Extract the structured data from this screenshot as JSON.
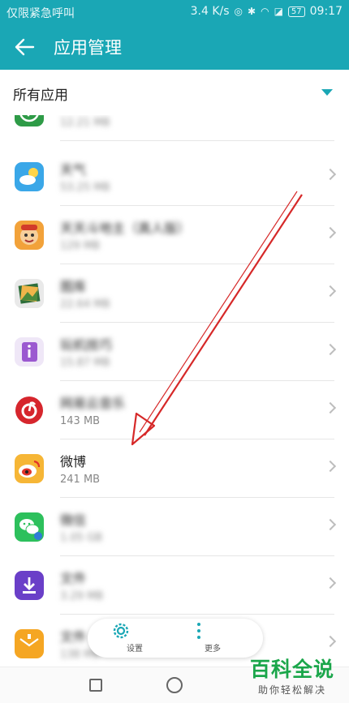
{
  "status_bar": {
    "carrier": "仅限紧急呼叫",
    "speed": "3.4 K/s",
    "battery": "57",
    "time": "09:17"
  },
  "header": {
    "title": "应用管理"
  },
  "filter": {
    "label": "所有应用"
  },
  "apps": [
    {
      "name": "",
      "size": "12.21 MB",
      "icon": "green-app-icon"
    },
    {
      "name": "天气",
      "size": "53.25 MB",
      "icon": "weather-icon"
    },
    {
      "name": "天天斗地主（真人版）",
      "size": "129 MB",
      "icon": "doudizhu-icon"
    },
    {
      "name": "图库",
      "size": "22.64 MB",
      "icon": "gallery-icon"
    },
    {
      "name": "玩机技巧",
      "size": "15.87 MB",
      "icon": "tips-icon"
    },
    {
      "name": "网易云音乐",
      "size": "143 MB",
      "icon": "netease-music-icon"
    },
    {
      "name": "微博",
      "size": "241 MB",
      "icon": "weibo-icon"
    },
    {
      "name": "微信",
      "size": "1.05 GB",
      "icon": "wechat-icon"
    },
    {
      "name": "文件",
      "size": "3.29 MB",
      "icon": "download-icon"
    },
    {
      "name": "文件",
      "size": "138 MB",
      "icon": "archive-icon"
    }
  ],
  "bottom_actions": {
    "settings_label": "设置",
    "more_label": "更多"
  },
  "watermark": {
    "title": "百科全说",
    "subtitle": "助你轻松解决"
  },
  "colors": {
    "accent": "#1aa7b5",
    "annotation": "#d62828"
  }
}
